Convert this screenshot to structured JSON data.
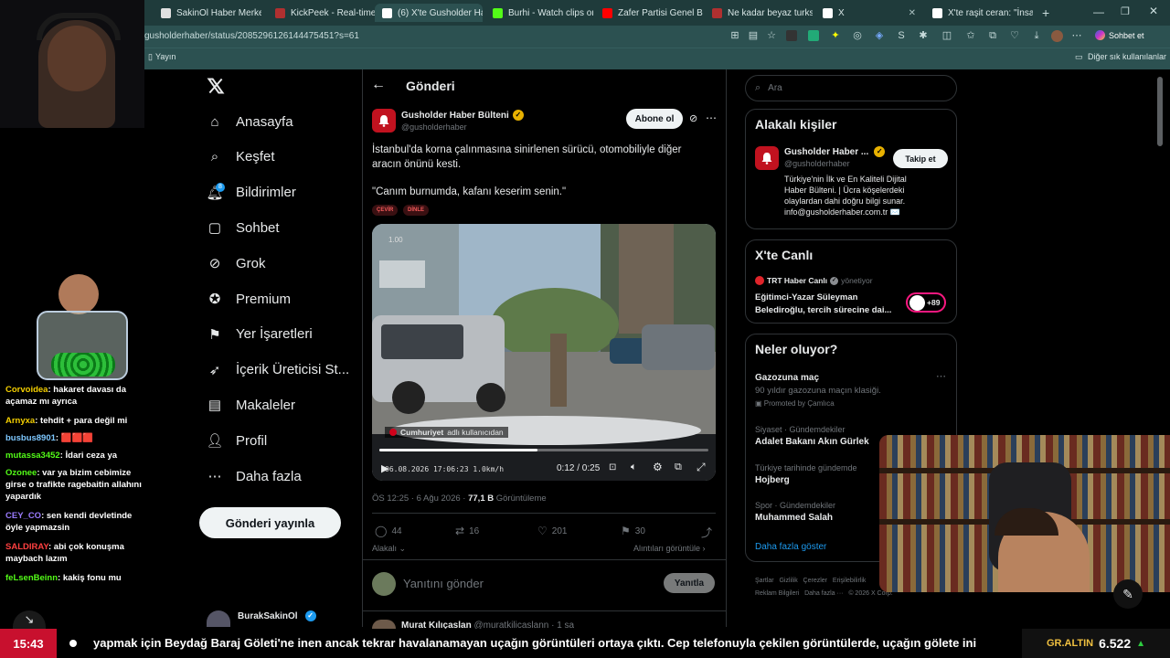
{
  "browser": {
    "tabs": [
      {
        "label": "SakinOl Haber Merkezi",
        "color": "#e0e0e0"
      },
      {
        "label": "KickPeek - Real-time Ul",
        "color": "#b03030"
      },
      {
        "label": "(6) X'te Gusholder Hab",
        "color": "#ffffff"
      },
      {
        "label": "Burhi - Watch clips on K",
        "color": "#53fc18"
      },
      {
        "label": "Zafer Partisi Genel Başk",
        "color": "#ff0000"
      },
      {
        "label": "Ne kadar beyaz turksun",
        "color": "#b03030"
      },
      {
        "label": "X",
        "color": "#ffffff"
      },
      {
        "label": "X'te raşit ceran: \"İnsanı",
        "color": "#ffffff"
      }
    ],
    "url": "gusholderhaber/status/2085296126144475451?s=61",
    "bookmark_left": "Yayın",
    "bookmark_right": "Diğer sık kullanılanlar",
    "sync_label": "Sohbet et"
  },
  "nav": {
    "items": [
      "Anasayfa",
      "Keşfet",
      "Bildirimler",
      "Sohbet",
      "Grok",
      "Premium",
      "Yer İşaretleri",
      "İçerik Üreticisi St...",
      "Makaleler",
      "Profil",
      "Daha fazla"
    ],
    "notif_badge": "8",
    "post_button": "Gönderi yayınla",
    "account_name": "BurakSakinOl"
  },
  "main": {
    "header": "Gönderi",
    "author_name": "Gusholder Haber Bülteni",
    "author_handle": "@gusholderhaber",
    "subscribe": "Abone ol",
    "text_1": "İstanbul'da korna çalınmasına sinirlenen sürücü, otomobiliyle diğer aracın önünü kesti.",
    "text_2": "\"Canım burnumda, kafanı keserim senin.\"",
    "pills": [
      "ÇEVİR",
      "DİNLE"
    ],
    "video": {
      "time": "0:12 / 0:25",
      "caption_brand": "Cumhuriyet",
      "caption_rest": "adlı kullanıcıdan",
      "progress": 0.48,
      "dashcam": "06.08.2026 17:06:23  1.0km/h",
      "badge": "1.00"
    },
    "meta_time": "ÖS 12:25 · 6 Ağu 2026 · ",
    "meta_views": "77,1 B",
    "meta_views_label": " Görüntüleme",
    "stats": {
      "replies": "44",
      "reposts": "16",
      "likes": "201",
      "bookmarks": "30"
    },
    "related": "Alakalı",
    "quotes": "Alıntıları görüntüle",
    "reply_placeholder": "Yanıtını gönder",
    "reply_button": "Yanıtla",
    "next_author": "Murat Kılıçaslan",
    "next_handle": "@muratkilicaslann · 1 sa"
  },
  "right": {
    "search_placeholder": "Ara",
    "people_title": "Alakalı kişiler",
    "person_name": "Gusholder Haber ...",
    "person_handle": "@gusholderhaber",
    "follow": "Takip et",
    "person_bio": "Türkiye'nin İlk ve En Kaliteli Dijital Haber Bülteni. | Ücra köşelerdeki olaylardan dahi doğru bilgi sunar. info@gusholderhaber.com.tr ✉️",
    "live_title": "X'te Canlı",
    "live_host": "TRT Haber Canlı",
    "live_host_suffix": "yönetiyor",
    "live_text": "Eğitimci-Yazar Süleyman Belediroğlu, tercih sürecine dai...",
    "live_count": "+89",
    "trends_title": "Neler oluyor?",
    "trends": [
      {
        "cat": "",
        "name": "Gazozuna maç",
        "sub": "90 yıldır gazozuna maçın klasiği.",
        "promo": "Promoted by Çamlıca"
      },
      {
        "cat": "Siyaset · Gündemdekiler",
        "name": "Adalet Bakanı Akın Gürlek"
      },
      {
        "cat": "Türkiye tarihinde gündemde",
        "name": "Hojberg"
      },
      {
        "cat": "Spor · Gündemdekiler",
        "name": "Muhammed Salah"
      }
    ],
    "show_more": "Daha fazla göster",
    "footer": [
      "Şartlar",
      "Gizlilik",
      "Çerezler",
      "Erişilebilirlik",
      "Reklam Bilgileri",
      "Daha fazla ···",
      "© 2026 X Corp."
    ]
  },
  "stream": {
    "chat": [
      {
        "user": "Corvoidea",
        "msg": "hakaret davası da açamaz mı ayrıca",
        "color": "#f5d000"
      },
      {
        "user": "Arnyxa",
        "msg": "tehdit + para değil mi",
        "color": "#f5d000"
      },
      {
        "user": "busbus8901",
        "msg": "🟥🟥🟥",
        "color": "#7ec8ff"
      },
      {
        "user": "mutassa3452",
        "msg": "İdari ceza ya",
        "color": "#53fc18"
      },
      {
        "user": "Ozonee",
        "msg": "var ya bizim cebimize girse o trafikte ragebaitin allahını yapardık",
        "color": "#53fc18"
      },
      {
        "user": "CEY_CO",
        "msg": "sen kendi devletinde öyle yapmazsin",
        "color": "#9b7bff"
      },
      {
        "user": "SALDIRAY",
        "msg": "abi çok konuşma maybach lazım",
        "color": "#ff4040"
      },
      {
        "user": "feLsenBeinn",
        "msg": "kakiş fonu mu",
        "color": "#53fc18"
      }
    ],
    "clock": "15:43",
    "ticker_text": "yapmak için Beydağ Baraj Göleti'ne inen ancak tekrar havalanamayan uçağın görüntüleri ortaya çıktı. Cep telefonuyla çekilen görüntülerde, uçağın gölete ini",
    "gold_label": "GR.ALTIN",
    "gold_value": "6.522"
  }
}
